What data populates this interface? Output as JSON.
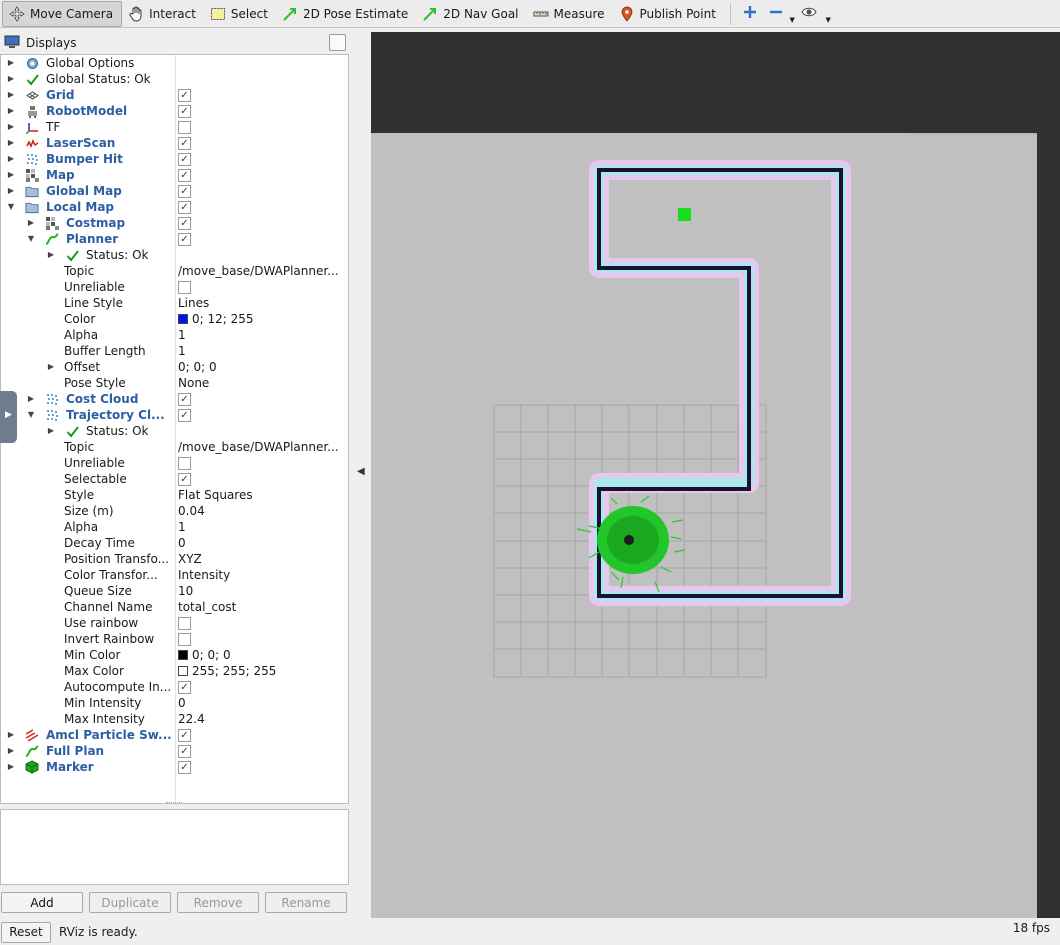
{
  "toolbar": {
    "tools": [
      {
        "label": "Move Camera",
        "icon": "move-camera-icon"
      },
      {
        "label": "Interact",
        "icon": "hand-icon"
      },
      {
        "label": "Select",
        "icon": "select-rect-icon"
      },
      {
        "label": "2D Pose Estimate",
        "icon": "pose-arrow-icon"
      },
      {
        "label": "2D Nav Goal",
        "icon": "goal-arrow-icon"
      },
      {
        "label": "Measure",
        "icon": "ruler-icon"
      },
      {
        "label": "Publish Point",
        "icon": "map-pin-icon"
      }
    ],
    "accent": "#2f6fd1"
  },
  "displays": {
    "title": "Displays",
    "rows": [
      {
        "label": "Global Options"
      },
      {
        "label": "Global Status: Ok"
      },
      {
        "label": "Grid"
      },
      {
        "label": "RobotModel"
      },
      {
        "label": "TF"
      },
      {
        "label": "LaserScan"
      },
      {
        "label": "Bumper Hit"
      },
      {
        "label": "Map"
      },
      {
        "label": "Global Map"
      },
      {
        "label": "Local Map"
      },
      {
        "label": "Costmap"
      },
      {
        "label": "Planner"
      },
      {
        "label": "Status: Ok"
      },
      {
        "label": "Topic",
        "value": "/move_base/DWAPlanner..."
      },
      {
        "label": "Unreliable"
      },
      {
        "label": "Line Style",
        "value": "Lines"
      },
      {
        "label": "Color",
        "value": "0; 12; 255",
        "swatch": "#000cff"
      },
      {
        "label": "Alpha",
        "value": "1"
      },
      {
        "label": "Buffer Length",
        "value": "1"
      },
      {
        "label": "Offset",
        "value": "0; 0; 0"
      },
      {
        "label": "Pose Style",
        "value": "None"
      },
      {
        "label": "Cost Cloud"
      },
      {
        "label": "Trajectory Cl..."
      },
      {
        "label": "Status: Ok"
      },
      {
        "label": "Topic",
        "value": "/move_base/DWAPlanner..."
      },
      {
        "label": "Unreliable"
      },
      {
        "label": "Selectable"
      },
      {
        "label": "Style",
        "value": "Flat Squares"
      },
      {
        "label": "Size (m)",
        "value": "0.04"
      },
      {
        "label": "Alpha",
        "value": "1"
      },
      {
        "label": "Decay Time",
        "value": "0"
      },
      {
        "label": "Position Transfo...",
        "value": "XYZ"
      },
      {
        "label": "Color Transfor...",
        "value": "Intensity"
      },
      {
        "label": "Queue Size",
        "value": "10"
      },
      {
        "label": "Channel Name",
        "value": "total_cost"
      },
      {
        "label": "Use rainbow"
      },
      {
        "label": "Invert Rainbow"
      },
      {
        "label": "Min Color",
        "value": "0; 0; 0",
        "swatch": "#000000"
      },
      {
        "label": "Max Color",
        "value": "255; 255; 255",
        "swatch": "#ffffff"
      },
      {
        "label": "Autocompute In..."
      },
      {
        "label": "Min Intensity",
        "value": "0"
      },
      {
        "label": "Max Intensity",
        "value": "22.4"
      },
      {
        "label": "Amcl Particle Sw..."
      },
      {
        "label": "Full Plan"
      },
      {
        "label": "Marker"
      }
    ]
  },
  "buttons": {
    "add": "Add",
    "duplicate": "Duplicate",
    "remove": "Remove",
    "rename": "Rename"
  },
  "statusbar": {
    "reset": "Reset",
    "message": "RViz is ready.",
    "fps": "18 fps"
  }
}
